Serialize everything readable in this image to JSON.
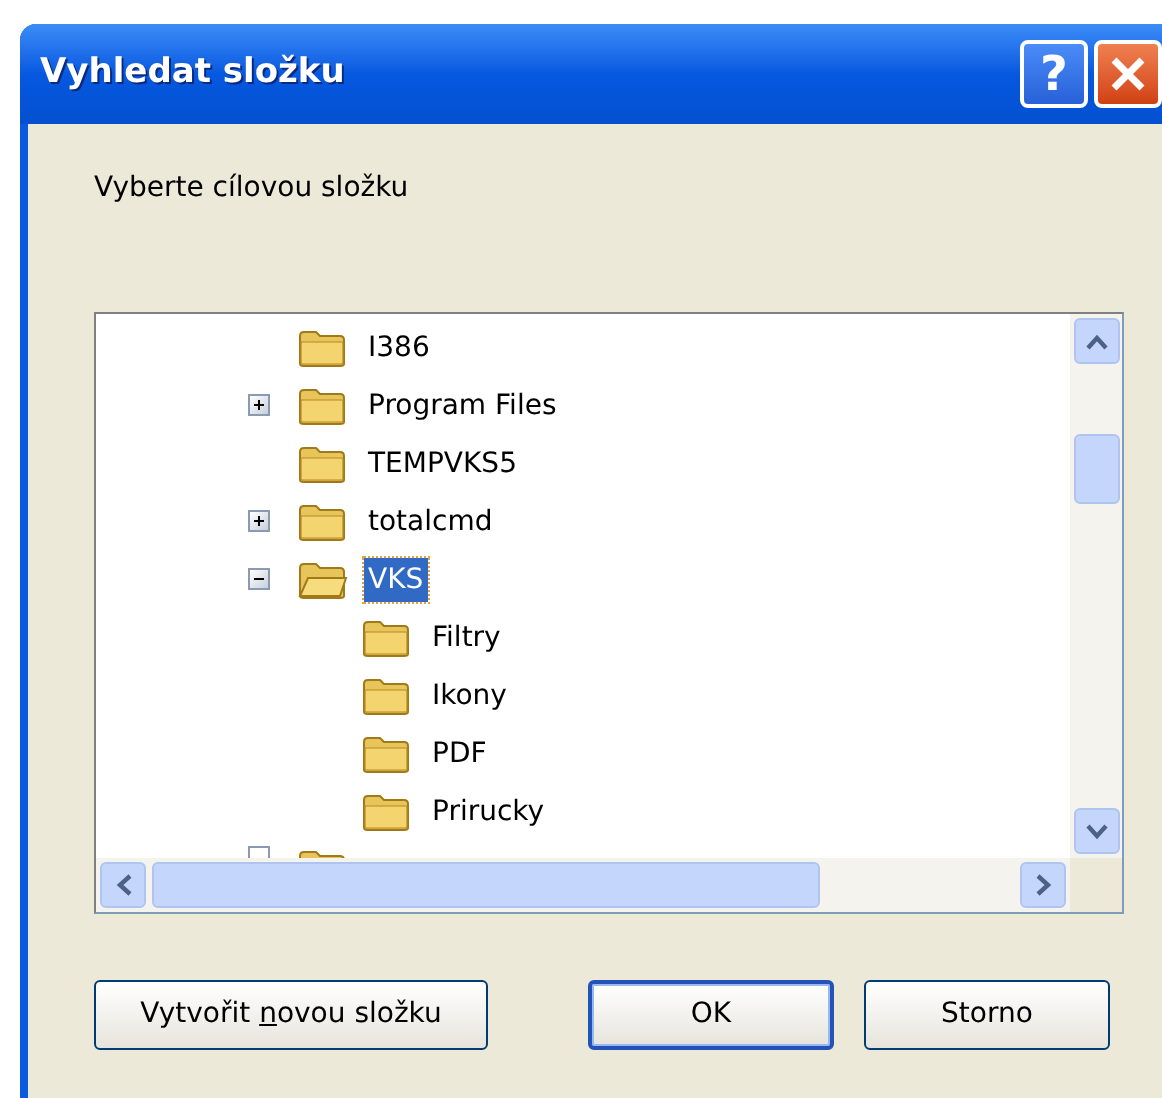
{
  "window": {
    "title": "Vyhledat složku",
    "help_symbol": "?"
  },
  "prompt": "Vyberte cílovou složku",
  "tree": {
    "items": [
      {
        "label": "I386",
        "has_children": false,
        "expanded": false,
        "selected": false
      },
      {
        "label": "Program Files",
        "has_children": true,
        "expanded": false,
        "selected": false
      },
      {
        "label": "TEMPVKS5",
        "has_children": false,
        "expanded": false,
        "selected": false
      },
      {
        "label": "totalcmd",
        "has_children": true,
        "expanded": false,
        "selected": false
      },
      {
        "label": "VKS",
        "has_children": true,
        "expanded": true,
        "selected": true,
        "children": [
          {
            "label": "Filtry",
            "has_children": false,
            "expanded": false,
            "selected": false
          },
          {
            "label": "Ikony",
            "has_children": false,
            "expanded": false,
            "selected": false
          },
          {
            "label": "PDF",
            "has_children": false,
            "expanded": false,
            "selected": false
          },
          {
            "label": "Prirucky",
            "has_children": false,
            "expanded": false,
            "selected": false
          }
        ]
      }
    ]
  },
  "buttons": [
    {
      "kind": "mnemonic",
      "before": "Vytvořit ",
      "key": "n",
      "after": "ovou složku",
      "default": false
    },
    {
      "kind": "plain",
      "label": "OK",
      "default": true
    },
    {
      "kind": "plain",
      "label": "Storno",
      "default": false
    }
  ]
}
